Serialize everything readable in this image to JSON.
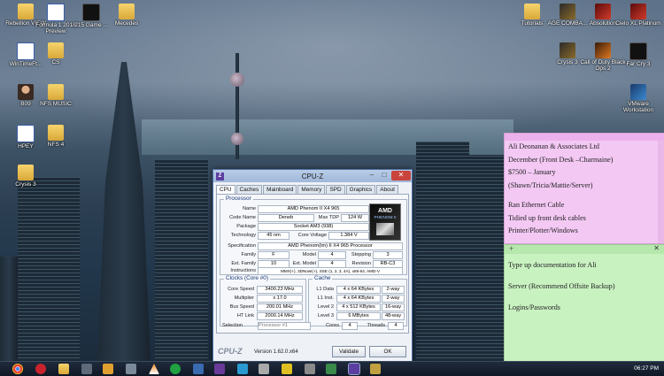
{
  "desktop": {
    "icons": [
      {
        "label": "Rebellion VIEW",
        "glyph": "folder"
      },
      {
        "label": "Formula 1 2018 Preview",
        "glyph": "doc"
      },
      {
        "label": "215 Game ...",
        "glyph": "dark"
      },
      {
        "label": "Mecedes",
        "glyph": "folder"
      },
      {
        "label": "Tutorials",
        "glyph": "folder"
      },
      {
        "label": "AGE COMBA...",
        "glyph": "game"
      },
      {
        "label": "Absolution",
        "glyph": "red"
      },
      {
        "label": "Cielo XL Platinum",
        "glyph": "red"
      },
      {
        "label": "WinTimeFt...",
        "glyph": "doc"
      },
      {
        "label": "CS",
        "glyph": "folder"
      },
      {
        "label": "Crysis 3",
        "glyph": "game"
      },
      {
        "label": "Call of Duty Black Ops 2",
        "glyph": "orange"
      },
      {
        "label": "Far Cry 3",
        "glyph": "dark"
      },
      {
        "label": "B09",
        "glyph": "person"
      },
      {
        "label": "NFS MUSIC",
        "glyph": "folder"
      },
      {
        "label": "VMware Workstation",
        "glyph": "blue"
      },
      {
        "label": "HPEY",
        "glyph": "doc"
      },
      {
        "label": "NFS 4",
        "glyph": "folder"
      },
      {
        "label": "Crysis 3",
        "glyph": "folder"
      }
    ]
  },
  "cpuz": {
    "title": "CPU-Z",
    "minimize": "–",
    "maximize": "□",
    "close": "✕",
    "tabs": [
      "CPU",
      "Caches",
      "Mainboard",
      "Memory",
      "SPD",
      "Graphics",
      "About"
    ],
    "active_tab": "CPU",
    "processor": {
      "group": "Processor",
      "name_label": "Name",
      "name": "AMD Phenom II X4 965",
      "code_name_label": "Code Name",
      "code_name": "Deneb",
      "max_tdp_label": "Max TDP",
      "max_tdp": "124 W",
      "package_label": "Package",
      "package": "Socket AM3 (938)",
      "technology_label": "Technology",
      "technology": "45 nm",
      "core_voltage_label": "Core Voltage",
      "core_voltage": "1.384 V",
      "specification_label": "Specification",
      "specification": "AMD Phenom(tm) II X4 965 Processor",
      "family_label": "Family",
      "family": "F",
      "model_label": "Model",
      "model": "4",
      "stepping_label": "Stepping",
      "stepping": "3",
      "ext_family_label": "Ext. Family",
      "ext_family": "10",
      "ext_model_label": "Ext. Model",
      "ext_model": "4",
      "revision_label": "Revision",
      "revision": "RB-C3",
      "instructions_label": "Instructions",
      "instructions": "MMX(+), 3DNow!(+), SSE (1, 2, 3, 4A), x86-64, AMD-V",
      "logo_brand": "AMD",
      "logo_product": "PHENOM II"
    },
    "clocks": {
      "group": "Clocks (Core #0)",
      "core_speed_label": "Core Speed",
      "core_speed": "3400.23 MHz",
      "multiplier_label": "Multiplier",
      "multiplier": "x 17.0",
      "bus_speed_label": "Bus Speed",
      "bus_speed": "200.01 MHz",
      "ht_link_label": "HT Link",
      "ht_link": "2000.14 MHz"
    },
    "cache": {
      "group": "Cache",
      "rows": [
        {
          "label": "L1 Data",
          "size": "4 x 64 KBytes",
          "way": "2-way"
        },
        {
          "label": "L1 Inst.",
          "size": "4 x 64 KBytes",
          "way": "2-way"
        },
        {
          "label": "Level 2",
          "size": "4 x 512 KBytes",
          "way": "16-way"
        },
        {
          "label": "Level 3",
          "size": "6 MBytes",
          "way": "48-way"
        }
      ]
    },
    "selection_label": "Selection",
    "selection_value": "Processor #1",
    "cores_label": "Cores",
    "cores": "4",
    "threads_label": "Threads",
    "threads": "4",
    "footer_logo": "CPU-Z",
    "version": "Version 1.62.0.x64",
    "validate_label": "Validate",
    "ok_label": "OK"
  },
  "sticky_pink": {
    "lines": [
      "Ali Deonanan & Associates Ltd",
      "December (Front Desk –Charmaine)",
      "$7500 – January",
      "(Shawn/Tricia/Mattie/Server)",
      "",
      "Ran Ethernet Cable",
      "Tidied up front desk cables",
      "Printer/Plotter/Windows"
    ]
  },
  "sticky_green": {
    "add": "+",
    "close": "✕",
    "lines": [
      "Type up documentation for Ali",
      "",
      "Server (Recommend Offsite Backup)",
      "",
      "Logins/Passwords"
    ]
  },
  "taskbar": {
    "time": "06:27 PM",
    "colors": {
      "bar": "#101826",
      "accent": "#5b3fa0"
    }
  }
}
